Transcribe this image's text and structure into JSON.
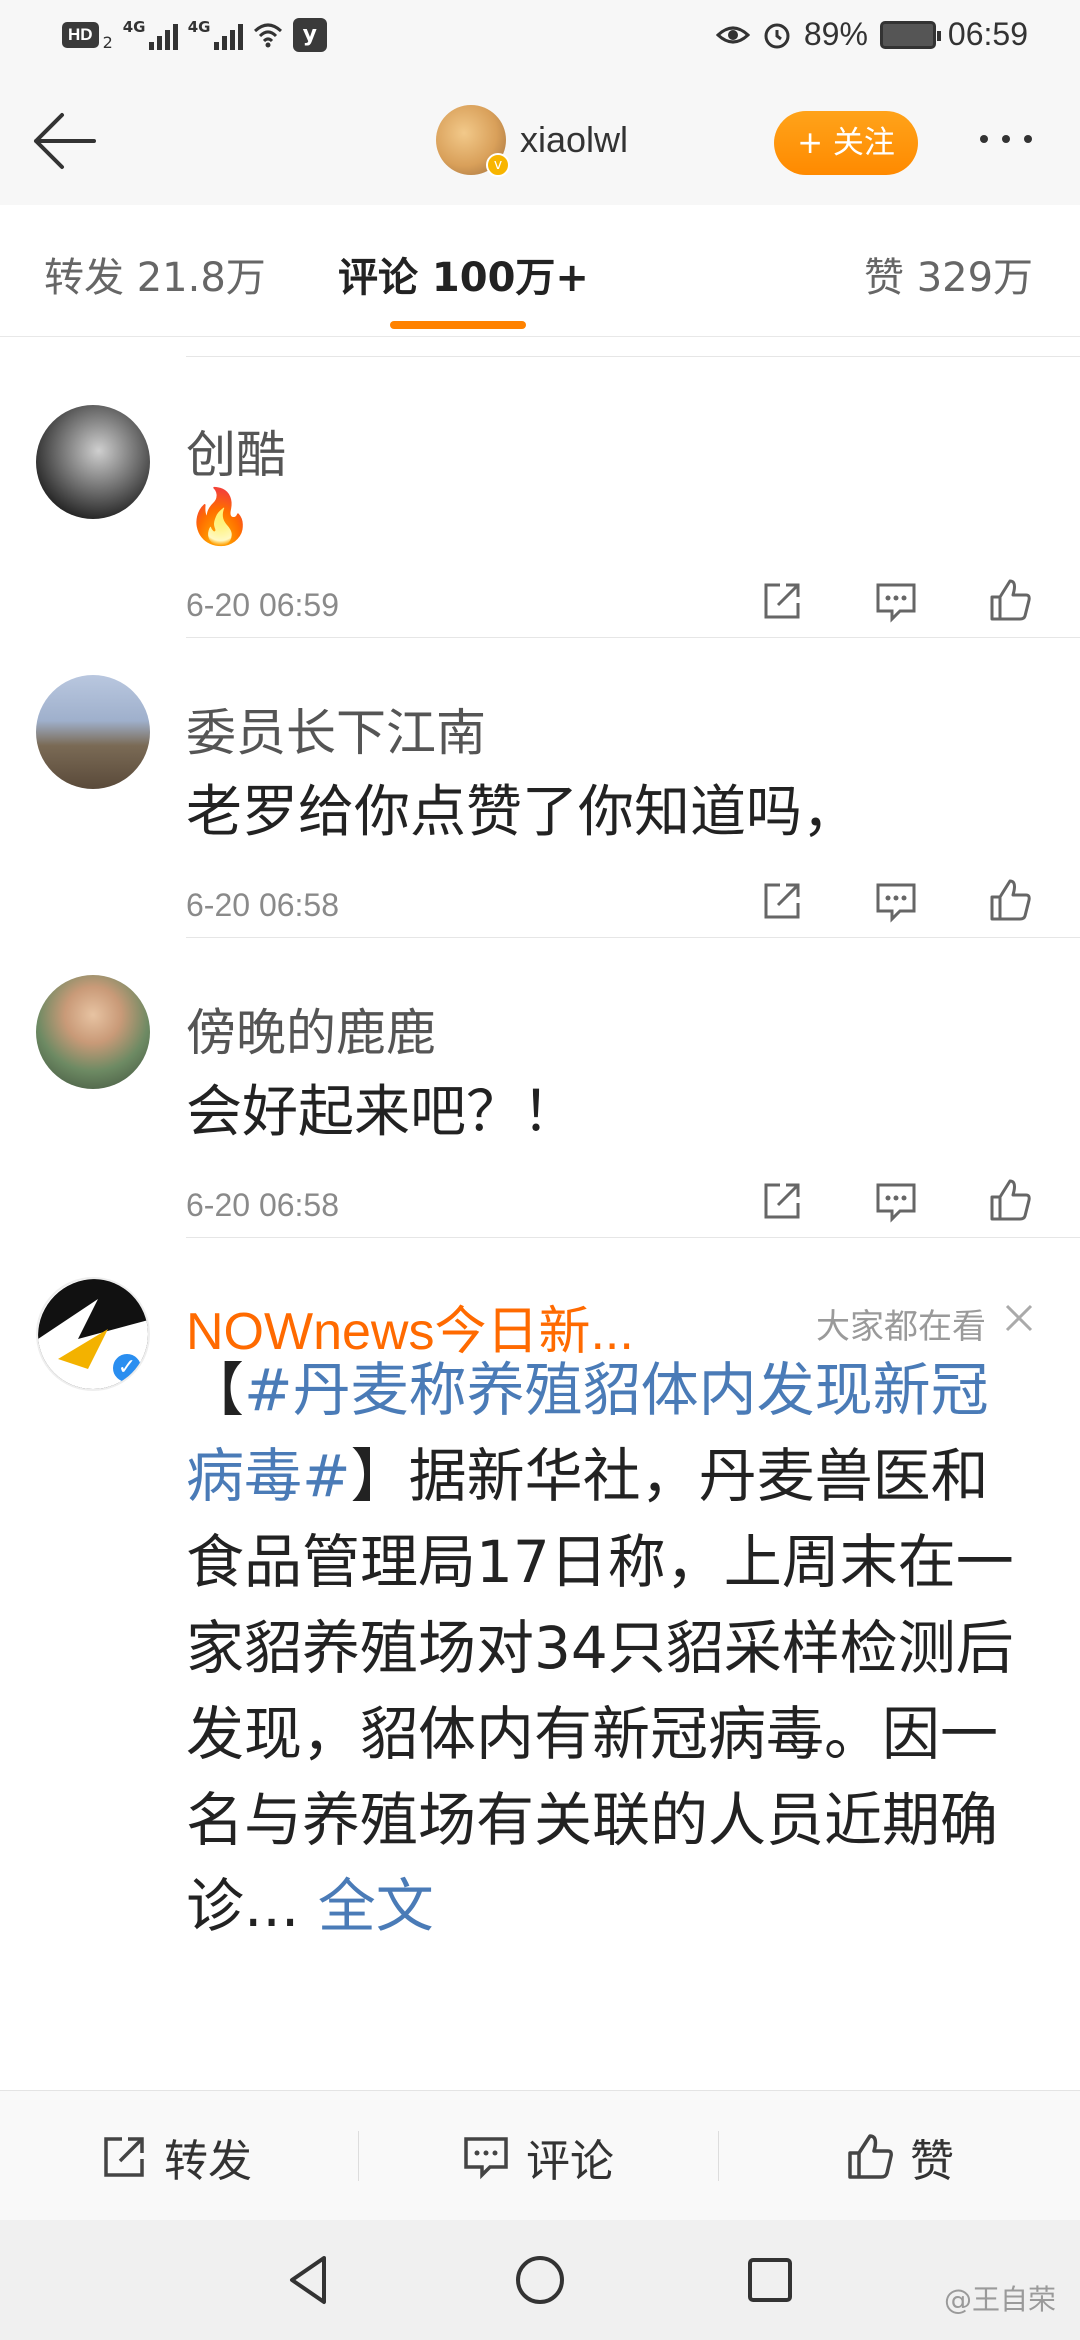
{
  "status_bar": {
    "hd_label": "HD",
    "hd_sub": "2",
    "net1": "4G",
    "net2": "4G",
    "app_icon_letter": "y",
    "battery": "89%",
    "time": "06:59"
  },
  "nav": {
    "username": "xiaolwl",
    "follow_label": "+ 关注"
  },
  "tabs": [
    {
      "label": "转发 21.8万"
    },
    {
      "label": "评论 100万+"
    },
    {
      "label": "赞 329万"
    }
  ],
  "comments": [
    {
      "name": "创酷",
      "text": "🔥",
      "time": "6-20 06:59"
    },
    {
      "name": "委员长下江南",
      "text": "老罗给你点赞了你知道吗，",
      "time": "6-20 06:58"
    },
    {
      "name": "傍晚的鹿鹿",
      "text": "会好起来吧？！",
      "time": "6-20 06:58"
    }
  ],
  "ad": {
    "name": "NOWnews今日新...",
    "tag": "大家都在看",
    "body_open": "【",
    "topic": "#丹麦称养殖貂体内发现新冠病毒#",
    "body_rest": "】据新华社，丹麦兽医和食品管理局17日称，上周末在一家貂养殖场对34只貂采样检测后发现，貂体内有新冠病毒。因一名与养殖场有关联的人员近期确诊...",
    "full_label": " 全文"
  },
  "bottom_bar": {
    "repost": "转发",
    "comment": "评论",
    "like": "赞"
  },
  "watermark": "@王自荣",
  "colors": {
    "accent": "#ff8200",
    "link": "#4a7bb7",
    "ad_name": "#ff6a00"
  }
}
